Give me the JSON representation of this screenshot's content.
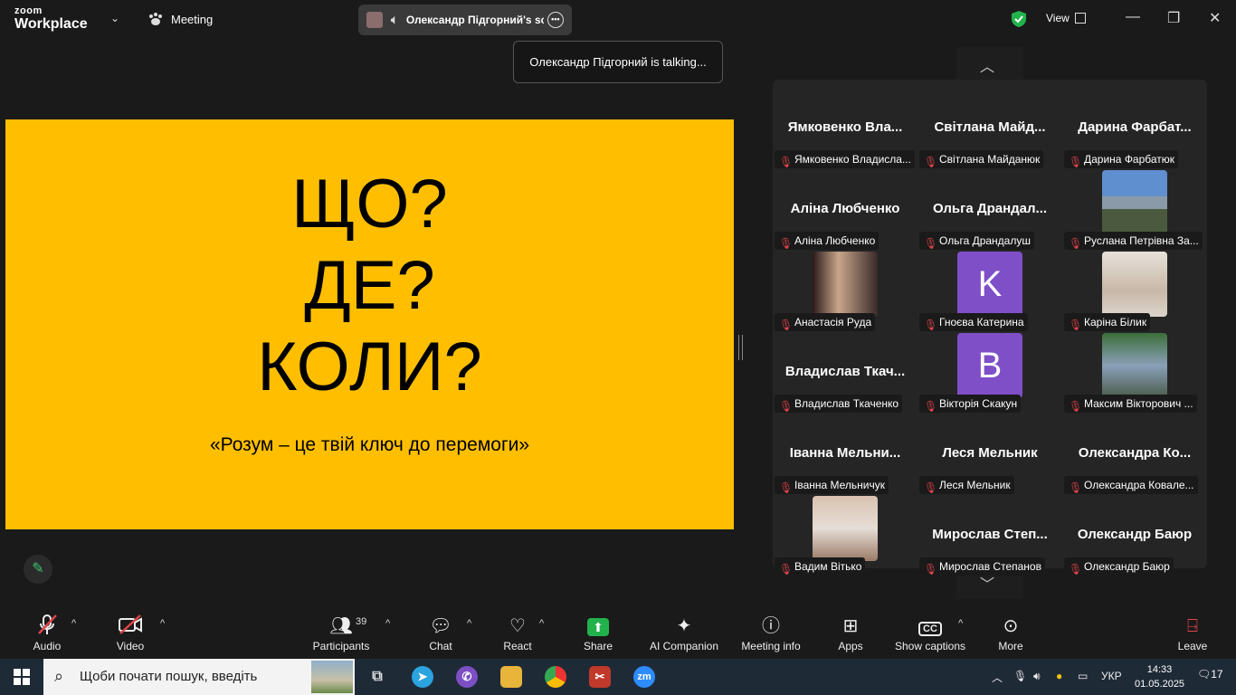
{
  "app": {
    "logo_line1": "zoom",
    "logo_line2": "Workplace",
    "meeting_label": "Meeting"
  },
  "share_pill": {
    "text": "Олександр Підгорний's scr"
  },
  "view_label": "View",
  "toast": "Олександр Підгорний is talking...",
  "slide": {
    "line1": "ЩО?",
    "line2": "ДЕ?",
    "line3": "КОЛИ?",
    "quote": "«Розум – це твій ключ до перемоги»"
  },
  "participants": [
    {
      "big": "Ямковенко Вла...",
      "label": "Ямковенко Владисла..."
    },
    {
      "big": "Світлана Майд...",
      "label": "Світлана Майданюк"
    },
    {
      "big": "Дарина Фарбат...",
      "label": "Дарина Фарбатюк"
    },
    {
      "big": "Аліна Любченко",
      "label": "Аліна Любченко"
    },
    {
      "big": "Ольга Драндал...",
      "label": "Ольга Драндалуш"
    },
    {
      "big": "",
      "label": "Руслана Петрівна За...",
      "photo": "photo-outdoor"
    },
    {
      "big": "",
      "label": "Анастасія Руда",
      "photo": "photo-dark"
    },
    {
      "big": "",
      "label": "Гноєва Катерина",
      "letter": "K"
    },
    {
      "big": "",
      "label": "Каріна Білик",
      "photo": "photo-light"
    },
    {
      "big": "Владислав Ткач...",
      "label": "Владислав Ткаченко"
    },
    {
      "big": "",
      "label": "Вікторія Скакун",
      "letter": "B"
    },
    {
      "big": "",
      "label": "Максим Вікторович ...",
      "photo": "photo-green"
    },
    {
      "big": "Іванна Мельни...",
      "label": "Іванна Мельничук"
    },
    {
      "big": "Леся Мельник",
      "label": "Леся Мельник"
    },
    {
      "big": "Олександра Ко...",
      "label": "Олександра Ковале..."
    },
    {
      "big": "",
      "label": "Вадим Вітько",
      "photo": "photo-room"
    },
    {
      "big": "Мирослав Степ...",
      "label": "Мирослав Степанов"
    },
    {
      "big": "Олександр Баюр",
      "label": "Олександр Баюр"
    }
  ],
  "toolbar": {
    "audio": "Audio",
    "video": "Video",
    "participants": "Participants",
    "participants_count": "39",
    "chat": "Chat",
    "react": "React",
    "share": "Share",
    "ai": "AI Companion",
    "info": "Meeting info",
    "apps": "Apps",
    "captions": "Show captions",
    "more": "More",
    "leave": "Leave"
  },
  "taskbar": {
    "search_placeholder": "Щоби почати пошук, введіть",
    "lang": "УКР",
    "time": "14:33",
    "date": "01.05.2025",
    "notifications": "17"
  },
  "colors": {
    "slide_bg": "#ffbf00",
    "share_green": "#22b24c",
    "muted_red": "#e0434a",
    "avatar_purple": "#7f4fc8"
  }
}
